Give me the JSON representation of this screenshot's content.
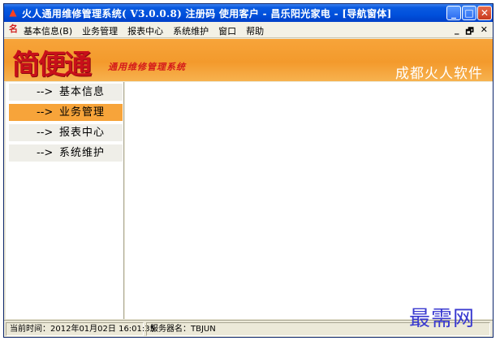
{
  "window": {
    "title": "火人通用维修管理系统( V3.0.0.8) 注册码 使用客户 - 昌乐阳光家电 - [导航窗体]",
    "buttons": {
      "minimize": "_",
      "maximize": "□",
      "close": "✕"
    }
  },
  "menubar": {
    "items": [
      "基本信息(B)",
      "业务管理",
      "报表中心",
      "系统维护",
      "窗口",
      "帮助"
    ],
    "mdi_controls": [
      "_",
      "🗗",
      "✕"
    ]
  },
  "banner": {
    "logo": "简便通",
    "slogan": "通用维修管理系统",
    "company": "成都火人软件"
  },
  "nav": {
    "arrow": "-->",
    "items": [
      {
        "label": "基本信息",
        "active": false
      },
      {
        "label": "业务管理",
        "active": true
      },
      {
        "label": "报表中心",
        "active": false
      },
      {
        "label": "系统维护",
        "active": false
      }
    ]
  },
  "status": {
    "time_label": "当前时间：2012年01月02日 16:01:35",
    "server_label": "服务器名：TBJUN"
  },
  "watermark": "最需网",
  "colors": {
    "accent": "#f7a43a",
    "titlebar": "#0050dc",
    "logo": "#c8101a"
  }
}
